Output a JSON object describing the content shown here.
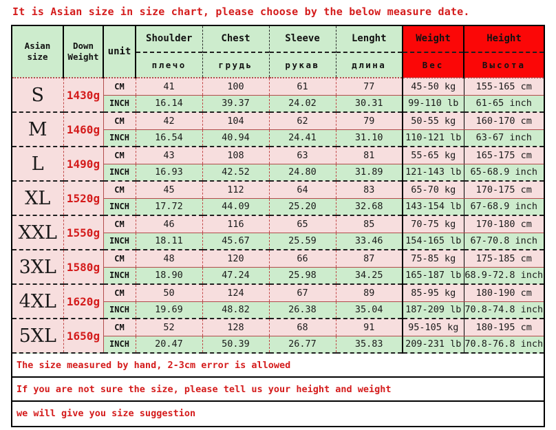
{
  "title": "It is Asian size in size chart, please choose by the below measure date.",
  "colors": {
    "title_red": "#d41b1b",
    "header_green": "#cdeccd",
    "header_red": "#fb0707",
    "cm_row_pink": "#f7dede",
    "inch_row_green": "#cdeccd"
  },
  "header": {
    "size_label": "Asian size",
    "down_weight_label": "Down Weight",
    "unit_label": "unit",
    "measure_columns": [
      {
        "en": "Shoulder",
        "ru": "плечо"
      },
      {
        "en": "Chest",
        "ru": "грудь"
      },
      {
        "en": "Sleeve",
        "ru": "рукав"
      },
      {
        "en": "Lenght",
        "ru": "длина"
      }
    ],
    "red_columns": [
      {
        "en": "Weight",
        "ru": "Вес"
      },
      {
        "en": "Height",
        "ru": "Высота"
      }
    ]
  },
  "units": {
    "cm": "CM",
    "inch": "INCH"
  },
  "rows": [
    {
      "size": "S",
      "down_weight": "1430g",
      "cm": {
        "shoulder": "41",
        "chest": "100",
        "sleeve": "61",
        "lenght": "77",
        "weight": "45-50 kg",
        "height": "155-165 cm"
      },
      "inch": {
        "shoulder": "16.14",
        "chest": "39.37",
        "sleeve": "24.02",
        "lenght": "30.31",
        "weight": "99-110 lb",
        "height": "61-65 inch"
      }
    },
    {
      "size": "M",
      "down_weight": "1460g",
      "cm": {
        "shoulder": "42",
        "chest": "104",
        "sleeve": "62",
        "lenght": "79",
        "weight": "50-55 kg",
        "height": "160-170 cm"
      },
      "inch": {
        "shoulder": "16.54",
        "chest": "40.94",
        "sleeve": "24.41",
        "lenght": "31.10",
        "weight": "110-121 lb",
        "height": "63-67 inch"
      }
    },
    {
      "size": "L",
      "down_weight": "1490g",
      "cm": {
        "shoulder": "43",
        "chest": "108",
        "sleeve": "63",
        "lenght": "81",
        "weight": "55-65 kg",
        "height": "165-175 cm"
      },
      "inch": {
        "shoulder": "16.93",
        "chest": "42.52",
        "sleeve": "24.80",
        "lenght": "31.89",
        "weight": "121-143 lb",
        "height": "65-68.9 inch"
      }
    },
    {
      "size": "XL",
      "down_weight": "1520g",
      "cm": {
        "shoulder": "45",
        "chest": "112",
        "sleeve": "64",
        "lenght": "83",
        "weight": "65-70 kg",
        "height": "170-175 cm"
      },
      "inch": {
        "shoulder": "17.72",
        "chest": "44.09",
        "sleeve": "25.20",
        "lenght": "32.68",
        "weight": "143-154 lb",
        "height": "67-68.9 inch"
      }
    },
    {
      "size": "XXL",
      "down_weight": "1550g",
      "cm": {
        "shoulder": "46",
        "chest": "116",
        "sleeve": "65",
        "lenght": "85",
        "weight": "70-75 kg",
        "height": "170-180 cm"
      },
      "inch": {
        "shoulder": "18.11",
        "chest": "45.67",
        "sleeve": "25.59",
        "lenght": "33.46",
        "weight": "154-165 lb",
        "height": "67-70.8 inch"
      }
    },
    {
      "size": "3XL",
      "down_weight": "1580g",
      "cm": {
        "shoulder": "48",
        "chest": "120",
        "sleeve": "66",
        "lenght": "87",
        "weight": "75-85 kg",
        "height": "175-185 cm"
      },
      "inch": {
        "shoulder": "18.90",
        "chest": "47.24",
        "sleeve": "25.98",
        "lenght": "34.25",
        "weight": "165-187 lb",
        "height": "68.9-72.8 inch"
      }
    },
    {
      "size": "4XL",
      "down_weight": "1620g",
      "cm": {
        "shoulder": "50",
        "chest": "124",
        "sleeve": "67",
        "lenght": "89",
        "weight": "85-95 kg",
        "height": "180-190 cm"
      },
      "inch": {
        "shoulder": "19.69",
        "chest": "48.82",
        "sleeve": "26.38",
        "lenght": "35.04",
        "weight": "187-209 lb",
        "height": "70.8-74.8 inch"
      }
    },
    {
      "size": "5XL",
      "down_weight": "1650g",
      "cm": {
        "shoulder": "52",
        "chest": "128",
        "sleeve": "68",
        "lenght": "91",
        "weight": "95-105 kg",
        "height": "180-195 cm"
      },
      "inch": {
        "shoulder": "20.47",
        "chest": "50.39",
        "sleeve": "26.77",
        "lenght": "35.83",
        "weight": "209-231 lb",
        "height": "70.8-76.8 inch"
      }
    }
  ],
  "notes": [
    "The size measured by hand, 2-3cm error is allowed",
    "If you are not sure the size, please tell us your height and weight",
    "we will give you size suggestion"
  ]
}
